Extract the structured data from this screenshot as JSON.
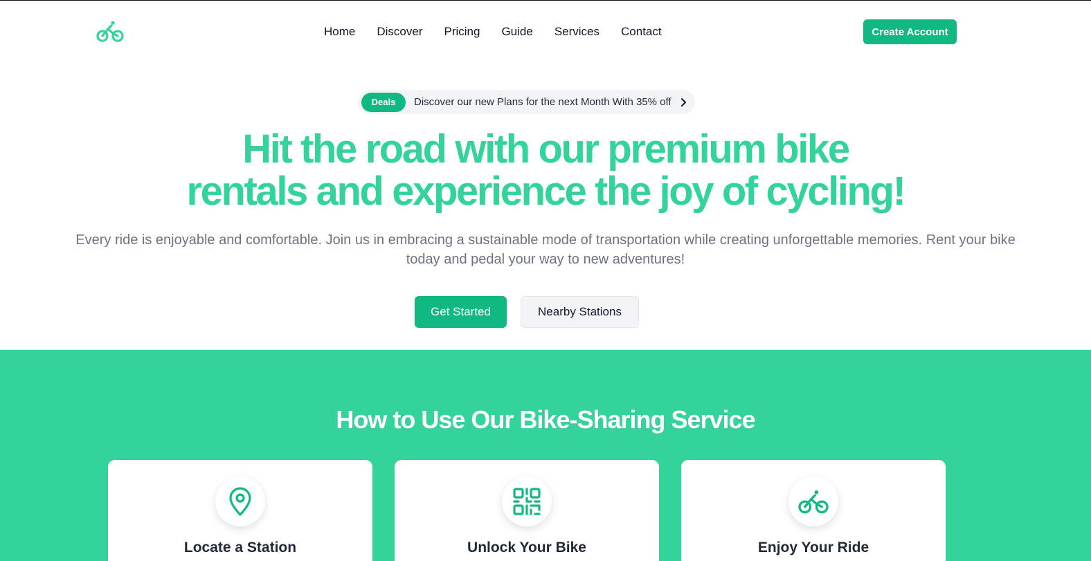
{
  "nav": {
    "logo_icon": "bicycle-icon",
    "items": [
      "Home",
      "Discover",
      "Pricing",
      "Guide",
      "Services",
      "Contact"
    ],
    "cta_label": "Create Account"
  },
  "deal": {
    "badge": "Deals",
    "text": "Discover our new Plans for the next Month With 35% off",
    "icon": "chevron-right-icon"
  },
  "hero": {
    "title_line1": "Hit the road with our premium bike",
    "title_line2": "rentals and experience the joy of cycling!",
    "subtitle_line1": "Every ride is enjoyable and comfortable. Join us in embracing a sustainable mode of transportation while creating unforgettable memories. Rent your bike",
    "subtitle_line2": "today and pedal your way to new adventures!",
    "primary_button": "Get Started",
    "secondary_button": "Nearby Stations"
  },
  "how": {
    "title": "How to Use Our Bike-Sharing Service",
    "cards": [
      {
        "icon": "map-pin-icon",
        "title": "Locate a Station"
      },
      {
        "icon": "qr-code-icon",
        "title": "Unlock Your Bike"
      },
      {
        "icon": "bicycle-icon",
        "title": "Enjoy Your Ride"
      }
    ]
  },
  "colors": {
    "brand": "#10b981",
    "brand_light": "#34d399",
    "text": "#111827",
    "muted": "#6b7280"
  }
}
